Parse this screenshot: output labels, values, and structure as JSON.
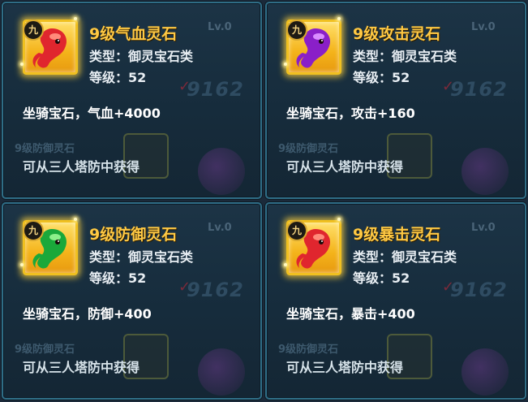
{
  "cards": [
    {
      "tier": "九",
      "title": "9级气血灵石",
      "type_label": "类型：御灵宝石类",
      "level_label": "等级：52",
      "description": "坐骑宝石，气血+4000",
      "source": "可从三人塔防中获得",
      "gem_color": "#e0262e",
      "gem_highlight": "#ff8a7a",
      "icon": "red-flame-gem-icon"
    },
    {
      "tier": "九",
      "title": "9级攻击灵石",
      "type_label": "类型：御灵宝石类",
      "level_label": "等级：52",
      "description": "坐骑宝石，攻击+160",
      "source": "可从三人塔防中获得",
      "gem_color": "#8a1fc8",
      "gem_highlight": "#d98cff",
      "icon": "purple-flame-gem-icon"
    },
    {
      "tier": "九",
      "title": "9级防御灵石",
      "type_label": "类型：御灵宝石类",
      "level_label": "等级：52",
      "description": "坐骑宝石，防御+400",
      "source": "可从三人塔防中获得",
      "gem_color": "#1aa83a",
      "gem_highlight": "#8cf08a",
      "icon": "green-flame-gem-icon"
    },
    {
      "tier": "九",
      "title": "9级暴击灵石",
      "type_label": "类型：御灵宝石类",
      "level_label": "等级：52",
      "description": "坐骑宝石，暴击+400",
      "source": "可从三人塔防中获得",
      "gem_color": "#e0262e",
      "gem_highlight": "#ff8a7a",
      "icon": "red-flame-gem-icon"
    }
  ],
  "background": {
    "level_text": "Lv.0",
    "score_text": "9162",
    "ghost_title": "9级防御灵石",
    "colors": {
      "title": "#ffc943",
      "frame": "#f0c020",
      "panel_border": "#2f6d86"
    }
  }
}
